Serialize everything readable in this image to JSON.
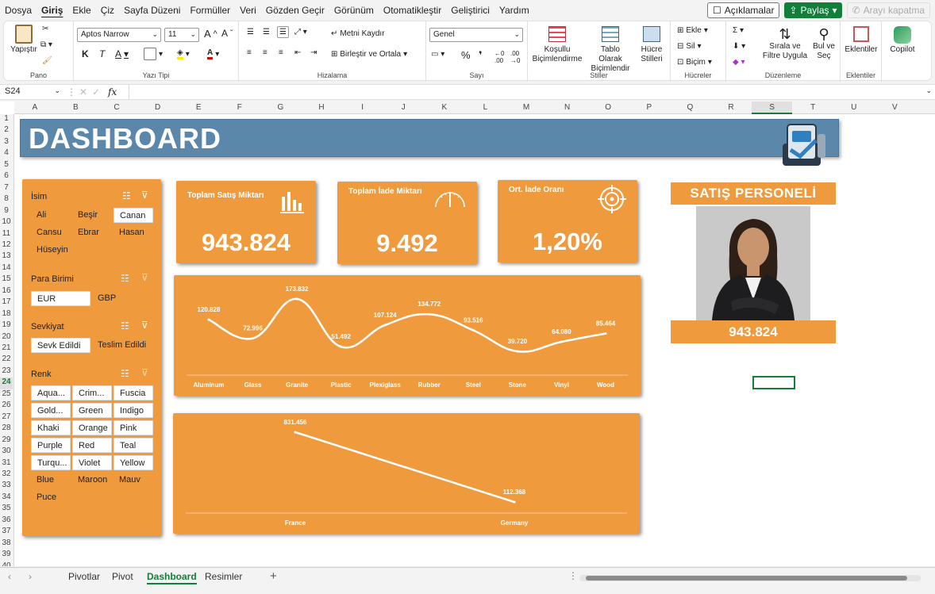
{
  "menu": {
    "items": [
      "Dosya",
      "Giriş",
      "Ekle",
      "Çiz",
      "Sayfa Düzeni",
      "Formüller",
      "Veri",
      "Gözden Geçir",
      "Görünüm",
      "Otomatikleştir",
      "Geliştirici",
      "Yardım"
    ],
    "active": "Giriş",
    "comments_label": "Açıklamalar",
    "share_label": "Paylaş",
    "call_label": "Arayı kapatma"
  },
  "ribbon": {
    "pano": {
      "label": "Pano",
      "paste": "Yapıştır"
    },
    "font": {
      "label": "Yazı Tipi",
      "name": "Aptos Narrow",
      "size": "11",
      "bold": "K",
      "italic": "T",
      "underline": "A"
    },
    "align": {
      "label": "Hizalama",
      "wrap": "Metni Kaydır",
      "merge": "Birleştir ve Ortala"
    },
    "number": {
      "label": "Sayı",
      "format": "Genel",
      "percent": "%",
      "comma": "❜"
    },
    "styles": {
      "label": "Stiller",
      "conditional": "Koşullu Biçimlendirme",
      "table": "Tablo Olarak Biçimlendir",
      "cell": "Hücre Stilleri"
    },
    "cells": {
      "label": "Hücreler",
      "insert": "Ekle",
      "delete": "Sil",
      "format": "Biçim"
    },
    "edit": {
      "label": "Düzenleme",
      "sort": "Sırala ve Filtre Uygula",
      "find": "Bul ve Seç"
    },
    "addins": {
      "label": "Eklentiler",
      "addins": "Eklentiler"
    },
    "copilot": {
      "label": "Copilot"
    }
  },
  "formula_bar": {
    "name_box": "S24",
    "fx": "fx",
    "content": ""
  },
  "columns": [
    "A",
    "B",
    "C",
    "D",
    "E",
    "F",
    "G",
    "H",
    "I",
    "J",
    "K",
    "L",
    "M",
    "N",
    "O",
    "P",
    "Q",
    "R",
    "S",
    "T",
    "U",
    "V"
  ],
  "selected_column": "S",
  "selected_row": "24",
  "rows": [
    "1",
    "2",
    "3",
    "4",
    "5",
    "6",
    "7",
    "8",
    "9",
    "10",
    "11",
    "12",
    "13",
    "14",
    "15",
    "16",
    "17",
    "18",
    "19",
    "20",
    "21",
    "22",
    "23",
    "24",
    "25",
    "26",
    "27",
    "28",
    "29",
    "30",
    "31",
    "32",
    "33",
    "34",
    "35",
    "36",
    "37",
    "38",
    "39",
    "40"
  ],
  "dashboard": {
    "title": "DASHBOARD",
    "slicers": {
      "name": {
        "title": "İsim",
        "items": [
          "Ali",
          "Beşir",
          "Canan",
          "Cansu",
          "Ebrar",
          "Hasan",
          "Hüseyin"
        ],
        "selected": "Canan"
      },
      "currency": {
        "title": "Para Birimi",
        "items": [
          "EUR",
          "GBP"
        ],
        "selected": "EUR"
      },
      "shipping": {
        "title": "Sevkiyat",
        "items": [
          "Sevk Edildi",
          "Teslim Edildi"
        ],
        "selected": "Sevk Edildi"
      },
      "color": {
        "title": "Renk",
        "items": [
          "Aqua...",
          "Crim...",
          "Fuscia",
          "Gold...",
          "Green",
          "Indigo",
          "Khaki",
          "Orange",
          "Pink",
          "Purple",
          "Red",
          "Teal",
          "Turqu...",
          "Violet",
          "Yellow",
          "Blue",
          "Maroon",
          "Mauv",
          "Puce"
        ],
        "selected_count": 15
      }
    },
    "kpis": [
      {
        "label": "Toplam Satış Miktarı",
        "value": "943.824",
        "icon": "bar-chart-icon"
      },
      {
        "label": "Toplam İade Miktarı",
        "value": "9.492",
        "icon": "gauge-icon"
      },
      {
        "label": "Ort. İade Oranı",
        "value": "1,20%",
        "icon": "target-icon"
      }
    ],
    "sales_person": {
      "title": "SATIŞ PERSONELİ",
      "value": "943.824"
    }
  },
  "chart_data": [
    {
      "type": "line",
      "smooth": true,
      "categories": [
        "Aluminum",
        "Glass",
        "Granite",
        "Plastic",
        "Plexiglass",
        "Rubber",
        "Steel",
        "Stone",
        "Vinyl",
        "Wood"
      ],
      "values": [
        120828,
        72996,
        173832,
        51492,
        107124,
        134772,
        93516,
        39720,
        64080,
        85464
      ],
      "labels": [
        "120.828",
        "72.996",
        "173.832",
        "51.492",
        "107.124",
        "134.772",
        "93.516",
        "39.720",
        "64.080",
        "85.464"
      ],
      "grid": false,
      "legend": "none"
    },
    {
      "type": "line",
      "categories": [
        "France",
        "Germany"
      ],
      "values": [
        831456,
        112368
      ],
      "labels": [
        "831.456",
        "112.368"
      ],
      "grid": false,
      "legend": "none"
    }
  ],
  "sheet_tabs": [
    "Pivotlar",
    "Pivot",
    "Dashboard",
    "Resimler"
  ],
  "active_tab": "Dashboard",
  "colors": {
    "accent_orange": "#f09a3e",
    "banner_blue": "#5b87ab",
    "excel_green": "#117e3a"
  }
}
